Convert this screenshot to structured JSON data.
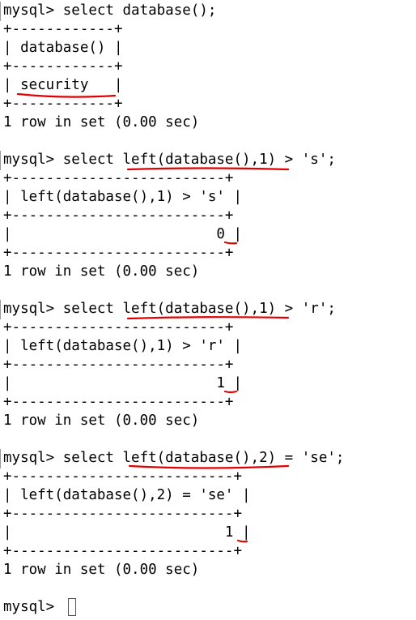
{
  "terminal": {
    "lines": [
      "mysql> select database();",
      "+------------+",
      "| database() |",
      "+------------+",
      "| security   |",
      "+------------+",
      "1 row in set (0.00 sec)",
      "",
      "mysql> select left(database(),1) > 's';",
      "+-------------------------+",
      "| left(database(),1) > 's' |",
      "+-------------------------+",
      "|                        0 |",
      "+-------------------------+",
      "1 row in set (0.00 sec)",
      "",
      "mysql> select left(database(),1) > 'r';",
      "+-------------------------+",
      "| left(database(),1) > 'r' |",
      "+-------------------------+",
      "|                        1 |",
      "+-------------------------+",
      "1 row in set (0.00 sec)",
      "",
      "mysql> select left(database(),2) = 'se';",
      "+--------------------------+",
      "| left(database(),2) = 'se' |",
      "+--------------------------+",
      "|                         1 |",
      "+--------------------------+",
      "1 row in set (0.00 sec)",
      "",
      "mysql> "
    ]
  },
  "colors": {
    "text": "#000000",
    "background": "#ffffff",
    "annotation": "#e00000"
  }
}
